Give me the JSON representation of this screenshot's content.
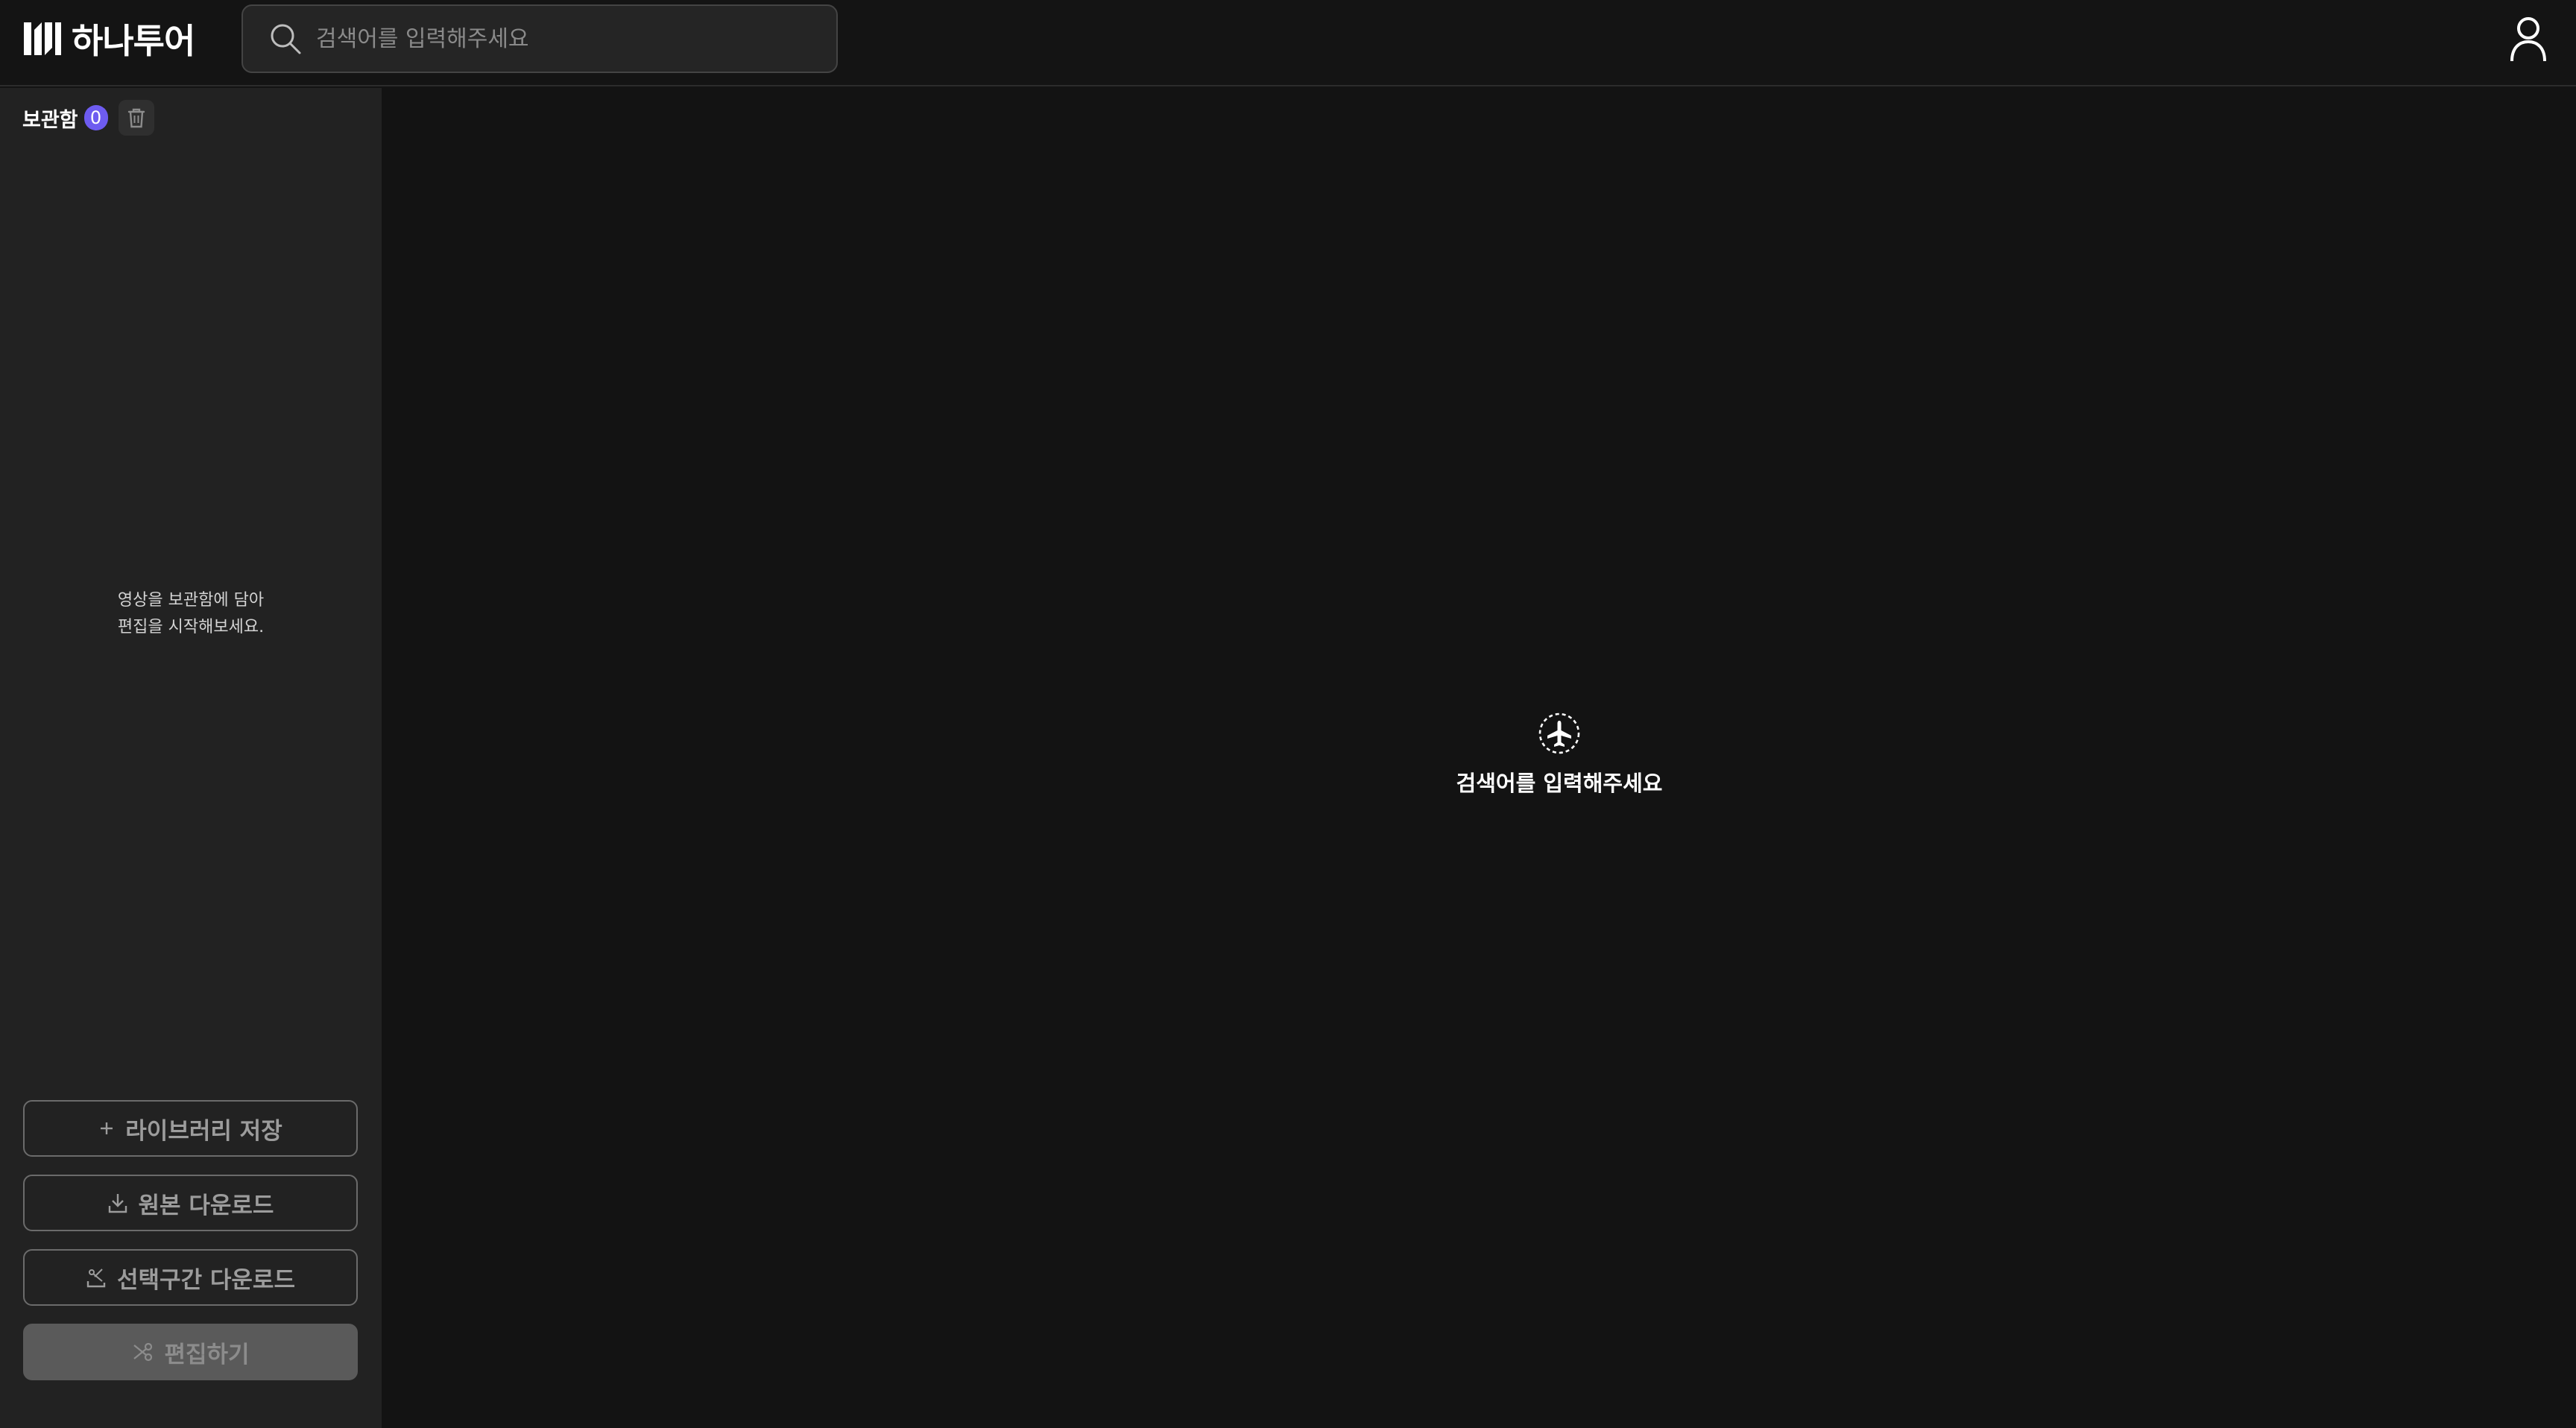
{
  "header": {
    "logo_text": "하나투어",
    "search_placeholder": "검색어를 입력해주세요",
    "search_value": ""
  },
  "sidebar": {
    "title": "보관함",
    "count": "0",
    "empty_line1": "영상을 보관함에 담아",
    "empty_line2": "편집을 시작해보세요.",
    "buttons": {
      "save_library": "라이브러리 저장",
      "download_original": "원본 다운로드",
      "download_range": "선택구간 다운로드",
      "edit": "편집하기"
    }
  },
  "main": {
    "empty_message": "검색어를 입력해주세요"
  },
  "colors": {
    "badge": "#6e5cf0",
    "background": "#131313",
    "sidebar": "#222222"
  },
  "icons": [
    "logo-icon",
    "search-icon",
    "user-icon",
    "trash-icon",
    "plus-icon",
    "download-icon",
    "scissors-download-icon",
    "scissors-icon",
    "airplane-icon"
  ]
}
